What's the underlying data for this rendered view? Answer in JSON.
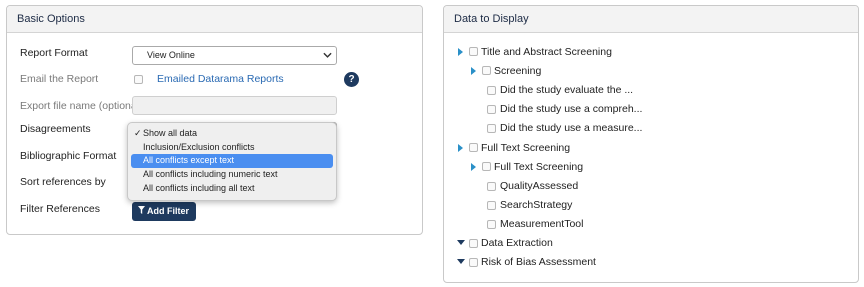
{
  "basic_options": {
    "title": "Basic Options",
    "report_format": {
      "label": "Report Format",
      "value": "View Online"
    },
    "email_report": {
      "label": "Email the Report",
      "link": "Emailed Datarama Reports",
      "help": "?"
    },
    "export_file": {
      "label": "Export file name (optional)",
      "value": ""
    },
    "disagreements": {
      "label": "Disagreements",
      "options": [
        {
          "label": "Show all data",
          "checked": true,
          "check_glyph": "✓"
        },
        {
          "label": "Inclusion/Exclusion conflicts"
        },
        {
          "label": "All conflicts except text",
          "highlighted": true
        },
        {
          "label": "All conflicts including numeric text"
        },
        {
          "label": "All conflicts including all text"
        }
      ]
    },
    "bibliographic_format": {
      "label": "Bibliographic Format"
    },
    "sort_references": {
      "label": "Sort references by"
    },
    "filter_references": {
      "label": "Filter References",
      "button": "Add Filter"
    }
  },
  "data_to_display": {
    "title": "Data to Display",
    "items": [
      {
        "label": "Title and Abstract Screening"
      },
      {
        "label": "Screening"
      },
      {
        "label": "Did the study evaluate the ..."
      },
      {
        "label": "Did the study use a compreh..."
      },
      {
        "label": "Did the study use a measure..."
      },
      {
        "label": "Full Text Screening"
      },
      {
        "label": "Full Text Screening"
      },
      {
        "label": "QualityAssessed"
      },
      {
        "label": "SearchStrategy"
      },
      {
        "label": "MeasurementTool"
      },
      {
        "label": "Data Extraction"
      },
      {
        "label": "Risk of Bias Assessment"
      }
    ]
  },
  "colors": {
    "accent": "#1e3a5f",
    "link": "#2a6ab3",
    "highlight": "#4a8ef0",
    "tree_arrow": "#2a90c8"
  }
}
